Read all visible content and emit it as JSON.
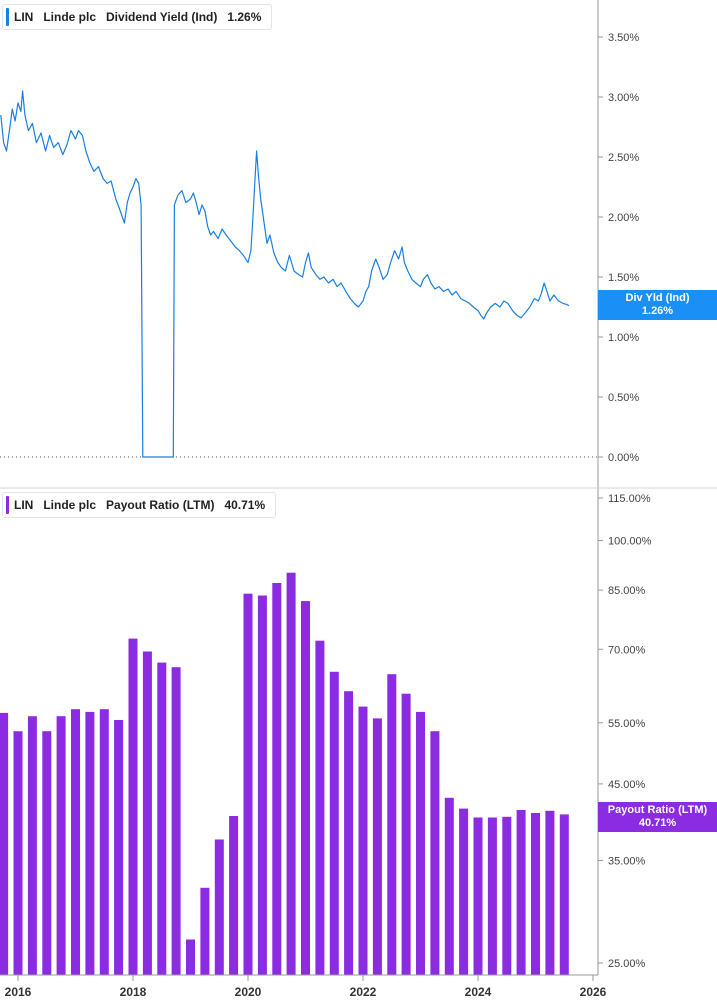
{
  "colors": {
    "yield": "#1a7fe0",
    "payout": "#8b2be2",
    "axis": "#9a9a9a",
    "text": "#444444"
  },
  "panels": {
    "top": {
      "ticker": "LIN",
      "company": "Linde plc",
      "metric": "Dividend Yield (Ind)",
      "value": "1.26%",
      "tag_name": "Div Yld (Ind)",
      "tag_value": "1.26%"
    },
    "bottom": {
      "ticker": "LIN",
      "company": "Linde plc",
      "metric": "Payout Ratio (LTM)",
      "value": "40.71%",
      "tag_name": "Payout Ratio (LTM)",
      "tag_value": "40.71%"
    }
  },
  "chart_data": [
    {
      "type": "line",
      "series": [
        {
          "name": "Dividend Yield (Ind)"
        }
      ],
      "x_ticks": [
        "2016",
        "2018",
        "2020",
        "2022",
        "2024",
        "2026"
      ],
      "y_ticks": [
        "0.00%",
        "0.50%",
        "1.00%",
        "1.50%",
        "2.00%",
        "2.50%",
        "3.00%",
        "3.50%"
      ],
      "ylim": [
        0,
        3.8
      ],
      "x_range": [
        2015.7,
        2026.0
      ],
      "points": [
        [
          2015.7,
          2.85
        ],
        [
          2015.75,
          2.62
        ],
        [
          2015.8,
          2.55
        ],
        [
          2015.85,
          2.72
        ],
        [
          2015.9,
          2.9
        ],
        [
          2015.95,
          2.8
        ],
        [
          2016.0,
          2.95
        ],
        [
          2016.05,
          2.88
        ],
        [
          2016.08,
          3.05
        ],
        [
          2016.12,
          2.85
        ],
        [
          2016.18,
          2.72
        ],
        [
          2016.25,
          2.78
        ],
        [
          2016.32,
          2.62
        ],
        [
          2016.4,
          2.7
        ],
        [
          2016.48,
          2.55
        ],
        [
          2016.55,
          2.68
        ],
        [
          2016.62,
          2.58
        ],
        [
          2016.7,
          2.62
        ],
        [
          2016.78,
          2.52
        ],
        [
          2016.85,
          2.6
        ],
        [
          2016.92,
          2.72
        ],
        [
          2017.0,
          2.65
        ],
        [
          2017.05,
          2.72
        ],
        [
          2017.12,
          2.68
        ],
        [
          2017.18,
          2.55
        ],
        [
          2017.25,
          2.45
        ],
        [
          2017.32,
          2.38
        ],
        [
          2017.4,
          2.42
        ],
        [
          2017.48,
          2.32
        ],
        [
          2017.55,
          2.28
        ],
        [
          2017.62,
          2.3
        ],
        [
          2017.7,
          2.15
        ],
        [
          2017.78,
          2.05
        ],
        [
          2017.85,
          1.95
        ],
        [
          2017.9,
          2.12
        ],
        [
          2017.95,
          2.2
        ],
        [
          2018.0,
          2.25
        ],
        [
          2018.05,
          2.32
        ],
        [
          2018.1,
          2.28
        ],
        [
          2018.14,
          2.1
        ],
        [
          2018.17,
          0.0
        ],
        [
          2018.7,
          0.0
        ],
        [
          2018.72,
          2.1
        ],
        [
          2018.78,
          2.18
        ],
        [
          2018.85,
          2.22
        ],
        [
          2018.92,
          2.12
        ],
        [
          2019.0,
          2.15
        ],
        [
          2019.05,
          2.2
        ],
        [
          2019.1,
          2.12
        ],
        [
          2019.15,
          2.02
        ],
        [
          2019.2,
          2.1
        ],
        [
          2019.25,
          2.05
        ],
        [
          2019.3,
          1.92
        ],
        [
          2019.35,
          1.85
        ],
        [
          2019.4,
          1.88
        ],
        [
          2019.48,
          1.82
        ],
        [
          2019.55,
          1.9
        ],
        [
          2019.62,
          1.85
        ],
        [
          2019.7,
          1.8
        ],
        [
          2019.78,
          1.75
        ],
        [
          2019.85,
          1.72
        ],
        [
          2019.92,
          1.68
        ],
        [
          2020.0,
          1.62
        ],
        [
          2020.05,
          1.72
        ],
        [
          2020.08,
          1.95
        ],
        [
          2020.12,
          2.3
        ],
        [
          2020.15,
          2.55
        ],
        [
          2020.18,
          2.35
        ],
        [
          2020.22,
          2.15
        ],
        [
          2020.28,
          1.95
        ],
        [
          2020.33,
          1.78
        ],
        [
          2020.38,
          1.85
        ],
        [
          2020.45,
          1.7
        ],
        [
          2020.52,
          1.62
        ],
        [
          2020.58,
          1.58
        ],
        [
          2020.65,
          1.55
        ],
        [
          2020.72,
          1.68
        ],
        [
          2020.8,
          1.55
        ],
        [
          2020.88,
          1.52
        ],
        [
          2020.95,
          1.5
        ],
        [
          2021.0,
          1.62
        ],
        [
          2021.05,
          1.7
        ],
        [
          2021.1,
          1.58
        ],
        [
          2021.18,
          1.52
        ],
        [
          2021.25,
          1.48
        ],
        [
          2021.32,
          1.5
        ],
        [
          2021.4,
          1.45
        ],
        [
          2021.48,
          1.48
        ],
        [
          2021.55,
          1.42
        ],
        [
          2021.62,
          1.45
        ],
        [
          2021.7,
          1.38
        ],
        [
          2021.78,
          1.32
        ],
        [
          2021.85,
          1.28
        ],
        [
          2021.92,
          1.25
        ],
        [
          2022.0,
          1.3
        ],
        [
          2022.05,
          1.38
        ],
        [
          2022.1,
          1.42
        ],
        [
          2022.15,
          1.55
        ],
        [
          2022.22,
          1.65
        ],
        [
          2022.28,
          1.58
        ],
        [
          2022.35,
          1.48
        ],
        [
          2022.42,
          1.52
        ],
        [
          2022.48,
          1.62
        ],
        [
          2022.55,
          1.72
        ],
        [
          2022.62,
          1.65
        ],
        [
          2022.68,
          1.75
        ],
        [
          2022.72,
          1.62
        ],
        [
          2022.78,
          1.55
        ],
        [
          2022.85,
          1.48
        ],
        [
          2022.92,
          1.45
        ],
        [
          2023.0,
          1.42
        ],
        [
          2023.05,
          1.48
        ],
        [
          2023.12,
          1.52
        ],
        [
          2023.18,
          1.45
        ],
        [
          2023.25,
          1.4
        ],
        [
          2023.32,
          1.42
        ],
        [
          2023.4,
          1.38
        ],
        [
          2023.48,
          1.4
        ],
        [
          2023.55,
          1.35
        ],
        [
          2023.62,
          1.38
        ],
        [
          2023.7,
          1.32
        ],
        [
          2023.78,
          1.3
        ],
        [
          2023.85,
          1.28
        ],
        [
          2023.92,
          1.25
        ],
        [
          2024.0,
          1.22
        ],
        [
          2024.05,
          1.18
        ],
        [
          2024.1,
          1.15
        ],
        [
          2024.15,
          1.2
        ],
        [
          2024.22,
          1.25
        ],
        [
          2024.3,
          1.28
        ],
        [
          2024.38,
          1.25
        ],
        [
          2024.45,
          1.3
        ],
        [
          2024.52,
          1.28
        ],
        [
          2024.6,
          1.22
        ],
        [
          2024.68,
          1.18
        ],
        [
          2024.75,
          1.16
        ],
        [
          2024.82,
          1.2
        ],
        [
          2024.9,
          1.25
        ],
        [
          2024.98,
          1.32
        ],
        [
          2025.05,
          1.3
        ],
        [
          2025.1,
          1.36
        ],
        [
          2025.15,
          1.45
        ],
        [
          2025.2,
          1.38
        ],
        [
          2025.25,
          1.3
        ],
        [
          2025.32,
          1.35
        ],
        [
          2025.4,
          1.3
        ],
        [
          2025.48,
          1.28
        ],
        [
          2025.55,
          1.27
        ],
        [
          2025.58,
          1.26
        ]
      ]
    },
    {
      "type": "bar",
      "series": [
        {
          "name": "Payout Ratio (LTM)"
        }
      ],
      "x_ticks": [
        "2016",
        "2018",
        "2020",
        "2022",
        "2024",
        "2026"
      ],
      "y_ticks": [
        "25.00%",
        "35.00%",
        "45.00%",
        "55.00%",
        "70.00%",
        "85.00%",
        "100.00%",
        "115.00%"
      ],
      "y_scale": "log",
      "ylim": [
        24.5,
        115
      ],
      "x": [
        2015.75,
        2016.0,
        2016.25,
        2016.5,
        2016.75,
        2017.0,
        2017.25,
        2017.5,
        2017.75,
        2018.0,
        2018.25,
        2018.5,
        2018.75,
        2019.0,
        2019.25,
        2019.5,
        2019.75,
        2020.0,
        2020.25,
        2020.5,
        2020.75,
        2021.0,
        2021.25,
        2021.5,
        2021.75,
        2022.0,
        2022.25,
        2022.5,
        2022.75,
        2023.0,
        2023.25,
        2023.5,
        2023.75,
        2024.0,
        2024.25,
        2024.5,
        2024.75,
        2025.0,
        2025.25,
        2025.5
      ],
      "values": [
        56.8,
        53.5,
        56.2,
        53.5,
        56.2,
        57.5,
        57.0,
        57.5,
        55.5,
        72.5,
        69.5,
        67.0,
        66.0,
        27.0,
        32.0,
        37.5,
        40.5,
        84.0,
        83.5,
        87.0,
        90.0,
        82.0,
        72.0,
        65.0,
        61.0,
        58.0,
        55.8,
        64.5,
        60.5,
        57.0,
        53.5,
        43.0,
        41.5,
        40.3,
        40.3,
        40.4,
        41.3,
        40.9,
        41.2,
        40.71
      ]
    }
  ]
}
